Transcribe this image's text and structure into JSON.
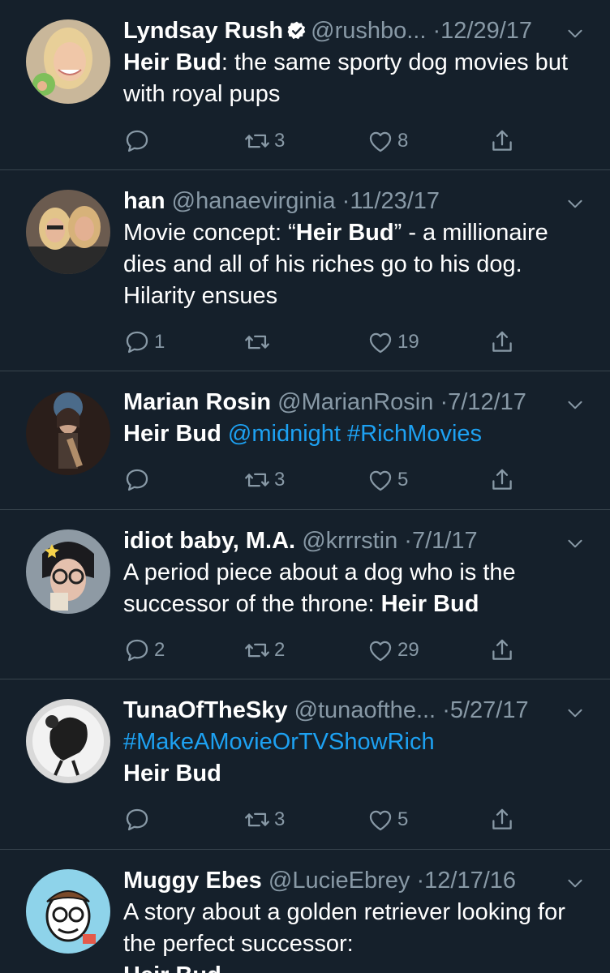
{
  "tweets": [
    {
      "name": "Lyndsay Rush",
      "verified": true,
      "handle": "@rushbo...",
      "date": "12/29/17",
      "body_bold": "Heir Bud",
      "body_rest": ": the same sporty dog movies but with royal pups",
      "replies": "",
      "retweets": "3",
      "likes": "8"
    },
    {
      "name": "han",
      "handle": "@hanaevirginia",
      "date": "11/23/17",
      "body_pre": "Movie concept: “",
      "body_bold": "Heir Bud",
      "body_post": "” - a millionaire dies and all of his riches go to his dog. Hilarity ensues",
      "replies": "1",
      "retweets": "",
      "likes": "19"
    },
    {
      "name": "Marian Rosin",
      "handle": "@MarianRosin",
      "date": "7/12/17",
      "body_bold": "Heir Bud",
      "body_link1": "@midnight",
      "body_link2": "#RichMovies",
      "replies": "",
      "retweets": "3",
      "likes": "5"
    },
    {
      "name": "idiot baby, M.A.",
      "handle": "@krrrstin",
      "date": "7/1/17",
      "body_pre": "A period piece about a dog who is the successor of the throne: ",
      "body_bold": "Heir Bud",
      "replies": "2",
      "retweets": "2",
      "likes": "29"
    },
    {
      "name": "TunaOfTheSky",
      "handle": "@tunaofthe...",
      "date": "5/27/17",
      "body_link1": "#MakeAMovieOrTVShowRich",
      "body_bold": "Heir Bud",
      "replies": "",
      "retweets": "3",
      "likes": "5"
    },
    {
      "name": "Muggy Ebes",
      "handle": "@LucieEbrey",
      "date": "12/17/16",
      "body_pre": "A story about a golden retriever looking for the perfect successor:",
      "body_bold": "Heir Bud"
    }
  ],
  "separator": "·",
  "colors": {
    "background": "#15202b",
    "secondary_text": "#8899a6",
    "link": "#1da1f2",
    "divider": "#38444d"
  },
  "icons": [
    "reply-icon",
    "retweet-icon",
    "like-icon",
    "share-icon",
    "chevron-down-icon",
    "verified-badge-icon"
  ]
}
